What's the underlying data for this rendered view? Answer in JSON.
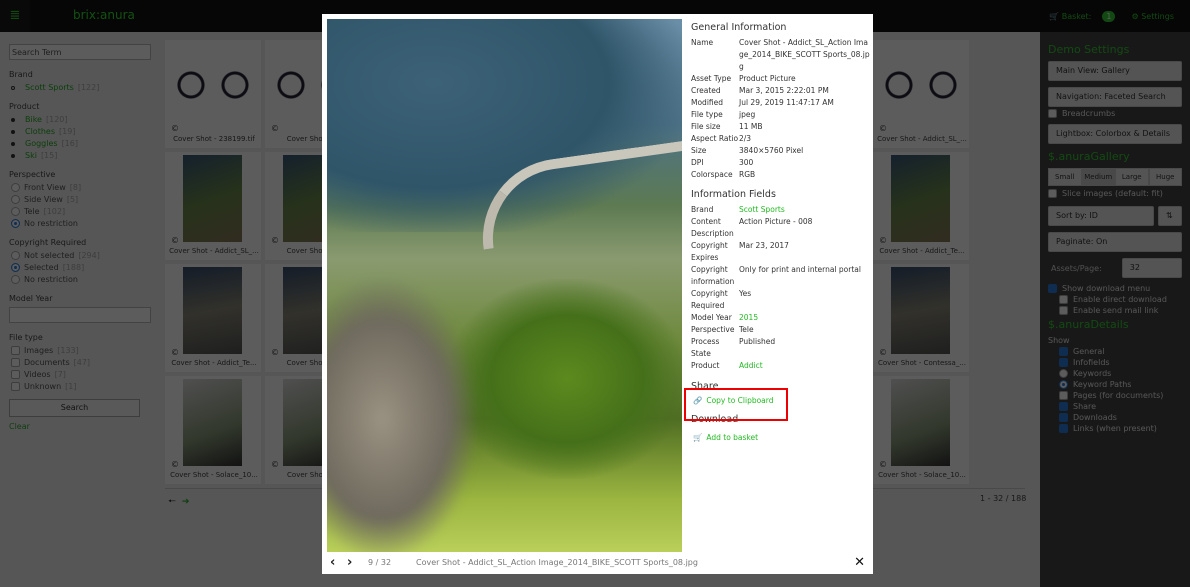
{
  "header": {
    "app_title": "brix:anura",
    "basket_label": "Basket:",
    "basket_count": "1",
    "settings_label": "Settings"
  },
  "sidebar": {
    "search_placeholder": "Search Term",
    "brand_label": "Brand",
    "brand_items": [
      {
        "label": "Scott Sports",
        "count": "[122]"
      }
    ],
    "product_label": "Product",
    "product_items": [
      {
        "label": "Bike",
        "count": "[120]"
      },
      {
        "label": "Clothes",
        "count": "[19]"
      },
      {
        "label": "Goggles",
        "count": "[16]"
      },
      {
        "label": "Ski",
        "count": "[15]"
      }
    ],
    "perspective_label": "Perspective",
    "perspective_items": [
      {
        "label": "Front View",
        "count": "[8]"
      },
      {
        "label": "Side View",
        "count": "[5]"
      },
      {
        "label": "Tele",
        "count": "[102]"
      },
      {
        "label": "No restriction",
        "count": "",
        "selected": true
      }
    ],
    "copyright_label": "Copyright Required",
    "copyright_items": [
      {
        "label": "Not selected",
        "count": "[294]"
      },
      {
        "label": "Selected",
        "count": "[188]",
        "selected": true
      },
      {
        "label": "No restriction",
        "count": ""
      }
    ],
    "model_year_label": "Model Year",
    "model_year_value": "",
    "filetype_label": "File type",
    "filetype_items": [
      {
        "label": "Images",
        "count": "[133]"
      },
      {
        "label": "Documents",
        "count": "[47]"
      },
      {
        "label": "Videos",
        "count": "[7]"
      },
      {
        "label": "Unknown",
        "count": "[1]"
      }
    ],
    "search_button": "Search",
    "clear_link": "Clear"
  },
  "gallery": {
    "copyright_icon": "©",
    "col1": [
      "Cover Shot - 238199.tif",
      "Cover Shot - Addict_SL_...",
      "Cover Shot - Addict_Te...",
      "Cover Shot - Solace_10..."
    ],
    "col2": [
      "Cover Shot - 22",
      "Cover Shot - Ad",
      "Cover Shot - Ad",
      "Cover Shot - Sc"
    ],
    "col_last": [
      "Cover Shot - Addict_SL_...",
      "Cover Shot - Addict_Te...",
      "Cover Shot - Contessa_...",
      "Cover Shot - Solace_10..."
    ],
    "pager_prev": "🠔",
    "pager_next": "➔",
    "count": "1 - 32 / 188"
  },
  "settings": {
    "demo_title": "Demo Settings",
    "main_view": "Main View: Gallery",
    "navigation": "Navigation: Faceted Search",
    "breadcrumbs": "Breadcrumbs",
    "lightbox": "Lightbox: Colorbox & Details",
    "gallery_title": "$.anuraGallery",
    "sizes": [
      "Small",
      "Medium",
      "Large",
      "Huge"
    ],
    "active_size": "Medium",
    "slice": "Slice images (default: fit)",
    "sort": "Sort by: ID",
    "sort_icon": "⇅",
    "paginate": "Paginate: On",
    "assets_label": "Assets/Page:",
    "assets_value": "32",
    "show_download": "Show download menu",
    "direct_download": "Enable direct download",
    "send_mail": "Enable send mail link",
    "details_title": "$.anuraDetails",
    "show_label": "Show",
    "show_items": [
      {
        "label": "General",
        "type": "check",
        "on": true
      },
      {
        "label": "Infofields",
        "type": "check",
        "on": true
      },
      {
        "label": "Keywords",
        "type": "radio",
        "on": false
      },
      {
        "label": "Keyword Paths",
        "type": "radio",
        "on": true
      },
      {
        "label": "Pages (for documents)",
        "type": "check",
        "on": false
      },
      {
        "label": "Share",
        "type": "check",
        "on": true
      },
      {
        "label": "Downloads",
        "type": "check",
        "on": true
      },
      {
        "label": "Links (when present)",
        "type": "check",
        "on": true
      }
    ]
  },
  "lightbox": {
    "position": "9 / 32",
    "filename": "Cover Shot - Addict_SL_Action Image_2014_BIKE_SCOTT Sports_08.jpg",
    "close_icon": "✕",
    "general_title": "General Information",
    "general": [
      [
        "Name",
        "Cover Shot - Addict_SL_Action Image_2014_BIKE_SCOTT Sports_08.jpg"
      ],
      [
        "Asset Type",
        "Product Picture"
      ],
      [
        "Created",
        "Mar 3, 2015 2:22:01 PM"
      ],
      [
        "Modified",
        "Jul 29, 2019 11:47:17 AM"
      ],
      [
        "File type",
        "jpeg"
      ],
      [
        "File size",
        "11 MB"
      ],
      [
        "Aspect Ratio",
        "2/3"
      ],
      [
        "Size",
        "3840×5760 Pixel"
      ],
      [
        "DPI",
        "300"
      ],
      [
        "Colorspace",
        "RGB"
      ]
    ],
    "fields_title": "Information Fields",
    "fields": [
      [
        "Brand",
        "Scott Sports",
        true
      ],
      [
        "Content Description",
        "Action Picture - 008",
        false
      ],
      [
        "Copyright Expires",
        "Mar 23, 2017",
        false
      ],
      [
        "Copyright information",
        "Only for print and internal portal",
        false
      ],
      [
        "Copyright Required",
        "Yes",
        false
      ],
      [
        "Model Year",
        "2015",
        true
      ],
      [
        "Perspective",
        "Tele",
        false
      ],
      [
        "Process State",
        "Published",
        false
      ],
      [
        "Product",
        "Addict",
        true
      ]
    ],
    "share_title": "Share",
    "copy_link": "Copy to Clipboard",
    "download_title": "Download",
    "basket_link": "Add to basket"
  },
  "colors": {
    "accent": "#33cc33",
    "highlight": "#ee0000"
  }
}
